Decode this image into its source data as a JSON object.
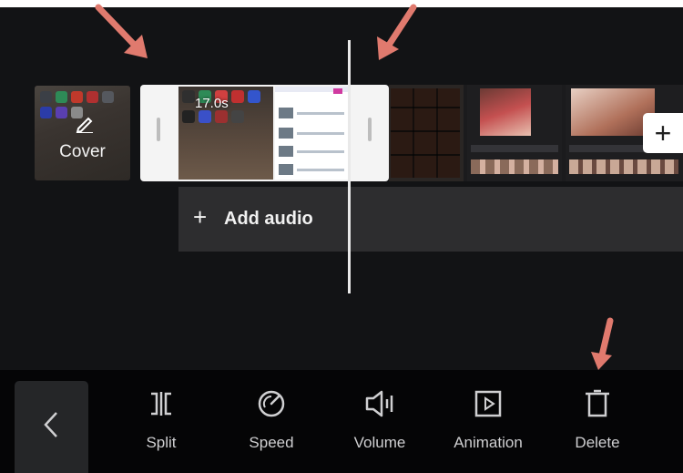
{
  "timeline": {
    "cover_label": "Cover",
    "clip_duration": "17.0s",
    "add_audio_label": "Add audio",
    "add_clip_symbol": "+"
  },
  "toolbar": {
    "back_icon": "chevron-left-icon",
    "tools": [
      {
        "label": "Split",
        "icon": "split-icon"
      },
      {
        "label": "Speed",
        "icon": "speed-icon"
      },
      {
        "label": "Volume",
        "icon": "volume-icon"
      },
      {
        "label": "Animation",
        "icon": "animation-icon"
      },
      {
        "label": "Delete",
        "icon": "delete-icon"
      }
    ]
  },
  "colors": {
    "background": "#111214",
    "toolbar": "#050506",
    "annotation_arrow": "#e07a6e",
    "selected_clip": "#f4f4f4",
    "audio_track": "#2d2d2f"
  }
}
